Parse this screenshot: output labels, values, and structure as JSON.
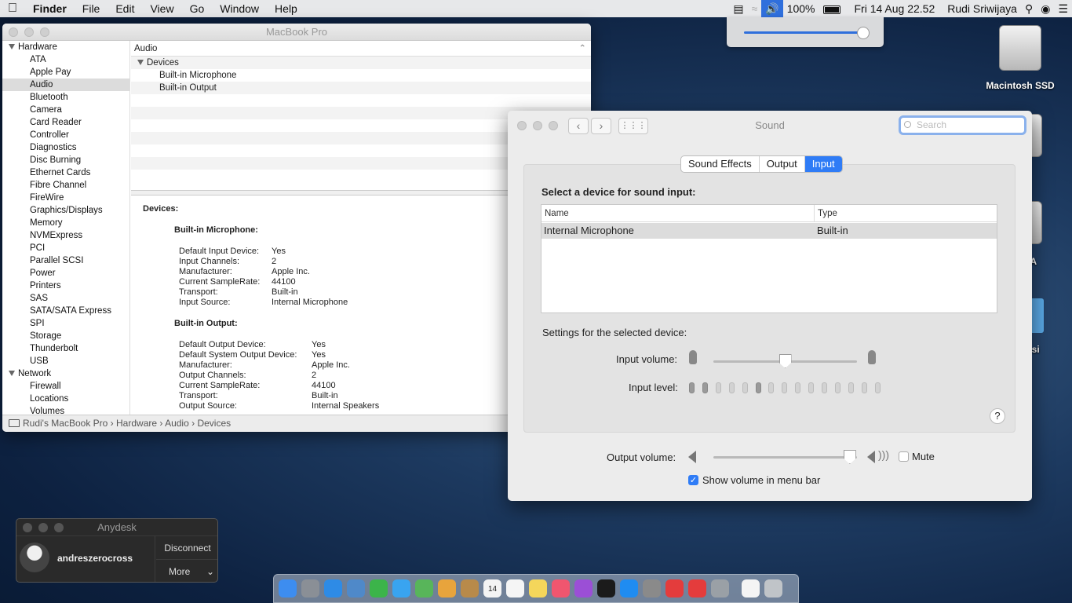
{
  "menubar": {
    "apple": "",
    "app": "Finder",
    "items": [
      "File",
      "Edit",
      "View",
      "Go",
      "Window",
      "Help"
    ],
    "battery_percent": "100%",
    "datetime": "Fri 14 Aug  22.52",
    "user": "Rudi Sriwijaya",
    "volume_level": 0.95
  },
  "desktop": {
    "icons": [
      "Macintosh SSD",
      "TA",
      "tasi"
    ]
  },
  "sysinfo": {
    "title": "MacBook Pro",
    "sidebar": {
      "hardware_label": "Hardware",
      "hardware_items": [
        "ATA",
        "Apple Pay",
        "Audio",
        "Bluetooth",
        "Camera",
        "Card Reader",
        "Controller",
        "Diagnostics",
        "Disc Burning",
        "Ethernet Cards",
        "Fibre Channel",
        "FireWire",
        "Graphics/Displays",
        "Memory",
        "NVMExpress",
        "PCI",
        "Parallel SCSI",
        "Power",
        "Printers",
        "SAS",
        "SATA/SATA Express",
        "SPI",
        "Storage",
        "Thunderbolt",
        "USB"
      ],
      "network_label": "Network",
      "network_items": [
        "Firewall",
        "Locations",
        "Volumes"
      ],
      "selected": "Audio"
    },
    "top_header": "Audio",
    "tree_group": "Devices",
    "tree_items": [
      "Built-in Microphone",
      "Built-in Output"
    ],
    "detail": {
      "devices_label": "Devices:",
      "mic_title": "Built-in Microphone:",
      "mic_rows": [
        {
          "k": "Default Input Device:",
          "v": "Yes"
        },
        {
          "k": "Input Channels:",
          "v": "2"
        },
        {
          "k": "Manufacturer:",
          "v": "Apple Inc."
        },
        {
          "k": "Current SampleRate:",
          "v": "44100"
        },
        {
          "k": "Transport:",
          "v": "Built-in"
        },
        {
          "k": "Input Source:",
          "v": "Internal Microphone"
        }
      ],
      "out_title": "Built-in Output:",
      "out_rows": [
        {
          "k": "Default Output Device:",
          "v": "Yes"
        },
        {
          "k": "Default System Output Device:",
          "v": "Yes"
        },
        {
          "k": "Manufacturer:",
          "v": "Apple Inc."
        },
        {
          "k": "Output Channels:",
          "v": "2"
        },
        {
          "k": "Current SampleRate:",
          "v": "44100"
        },
        {
          "k": "Transport:",
          "v": "Built-in"
        },
        {
          "k": "Output Source:",
          "v": "Internal Speakers"
        }
      ]
    },
    "path": [
      "Rudi's MacBook Pro",
      "Hardware",
      "Audio",
      "Devices"
    ]
  },
  "sound": {
    "title": "Sound",
    "search_placeholder": "Search",
    "tabs": [
      "Sound Effects",
      "Output",
      "Input"
    ],
    "active_tab": "Input",
    "select_label": "Select a device for sound input:",
    "col_name": "Name",
    "col_type": "Type",
    "device_name": "Internal Microphone",
    "device_type": "Built-in",
    "settings_label": "Settings for the selected device:",
    "input_volume_label": "Input volume:",
    "input_volume": 0.5,
    "input_level_label": "Input level:",
    "input_level_bars_lit": [
      0,
      1,
      5
    ],
    "input_level_bar_count": 15,
    "help": "?",
    "output_volume_label": "Output volume:",
    "output_volume": 0.95,
    "mute_label": "Mute",
    "mute_checked": false,
    "show_volume_label": "Show volume in menu bar",
    "show_volume_checked": true
  },
  "anydesk": {
    "title": "Anydesk",
    "user": "andreszerocross",
    "disconnect": "Disconnect",
    "more": "More"
  },
  "dock": {
    "apps": [
      "finder-icon",
      "launchpad-icon",
      "safari-icon",
      "preview-icon",
      "facetime-icon",
      "messages-icon",
      "maps-icon",
      "photos-icon",
      "notes-icon",
      "calendar-icon",
      "reminders-icon",
      "stickies-icon",
      "music-icon",
      "podcasts-icon",
      "tv-icon",
      "app-store-icon",
      "system-preferences-icon",
      "anydesk-icon",
      "anydesk-alt-icon",
      "utility-icon",
      "document-icon",
      "trash-icon"
    ],
    "colors": [
      "#3d8df0",
      "#8a8f96",
      "#2e8be6",
      "#4f89c9",
      "#3cb44a",
      "#39a4f0",
      "#58b55a",
      "#e8a43c",
      "#b88a4a",
      "#f4f4f4",
      "#f5f5f5",
      "#f4d65b",
      "#f0566f",
      "#9b4fd6",
      "#1b1b1b",
      "#1f8cf1",
      "#8a8a8a",
      "#e43c3c",
      "#e43c3c",
      "#9aa0a6",
      "#f4f4f4",
      "#c0c4c8"
    ],
    "calendar_day": "14"
  }
}
